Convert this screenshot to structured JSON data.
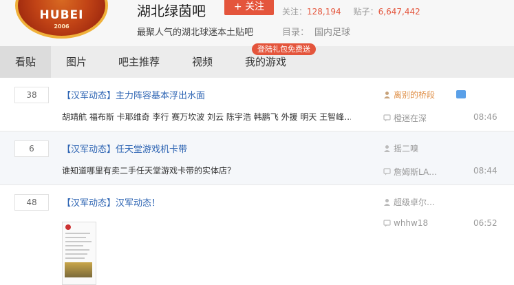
{
  "forum": {
    "logo_text": "HUBEI",
    "logo_year": "2006",
    "name": "湖北绿茵吧",
    "follow_label": "+ 关注",
    "followers_label": "关注：",
    "followers_count": "128,194",
    "posts_label": "贴子：",
    "posts_count": "6,647,442",
    "slogan": "最聚人气的湖北球迷本土贴吧",
    "category_label": "目录：",
    "category_value": "国内足球"
  },
  "nav": {
    "tabs": [
      "看贴",
      "图片",
      "吧主推荐",
      "视频",
      "我的游戏"
    ],
    "active": "看贴",
    "promo_badge": "登陆礼包免费送"
  },
  "threads": [
    {
      "reply_count": "38",
      "title": "【汉军动态】主力阵容基本浮出水面",
      "abstract": "胡靖航 福布斯 卡耶维奇 李行 赛万坎波 刘云 陈宇浩 韩鹏飞 外援 明天 王智峰…",
      "author": "离别的桥段",
      "last_replier": "橙迷在深",
      "time": "08:46"
    },
    {
      "reply_count": "6",
      "title": "【汉军动态】任天堂游戏机卡带",
      "abstract": "谁知道哪里有卖二手任天堂游戏卡带的实体店？",
      "author": "摇二嗅",
      "last_replier": "詹姆斯LA…",
      "time": "08:44"
    },
    {
      "reply_count": "48",
      "title": "【汉军动态】汉军动态！",
      "abstract": "",
      "author": "超级卓尔…",
      "last_replier": "whhw18",
      "time": "06:52"
    }
  ],
  "colors": {
    "accent_red": "#e4553c",
    "link_blue": "#2d64b3",
    "author_orange": "#e0914a",
    "badge_blue": "#5aa0e8"
  }
}
